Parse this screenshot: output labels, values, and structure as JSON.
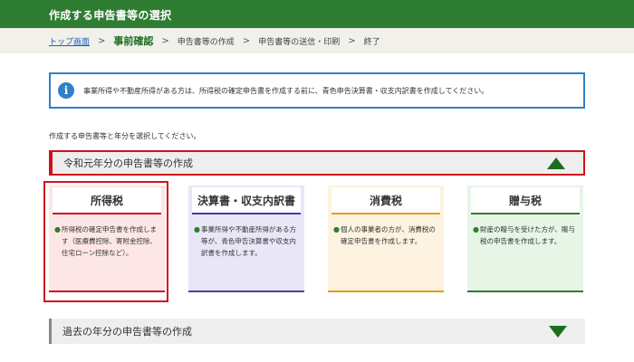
{
  "header": {
    "title": "作成する申告書等の選択"
  },
  "breadcrumb": {
    "items": [
      {
        "label": "トップ画面"
      },
      {
        "label": "事前確認"
      },
      {
        "label": "申告書等の作成"
      },
      {
        "label": "申告書等の送信・印刷"
      },
      {
        "label": "終了"
      }
    ],
    "separator": ">"
  },
  "info": {
    "icon": "i",
    "text": "事業所得や不動産所得がある方は、所得税の確定申告書を作成する前に、青色申告決算書・収支内訳書を作成してください。"
  },
  "instruction": "作成する申告書等と年分を選択してください。",
  "current_year": {
    "title": "令和元年分の申告書等の作成",
    "cards": [
      {
        "label": "所得税",
        "desc": "所得税の確定申告書を作成します（医療費控除、寄附金控除、住宅ローン控除など）。"
      },
      {
        "label": "決算書・収支内訳書",
        "desc": "事業所得や不動産所得がある方等が、青色申告決算書や収支内訳書を作成します。"
      },
      {
        "label": "消費税",
        "desc": "個人の事業者の方が、消費税の確定申告書を作成します。"
      },
      {
        "label": "贈与税",
        "desc": "財産の贈与を受けた方が、贈与税の申告書を作成します。"
      }
    ]
  },
  "past_years": {
    "title": "過去の年分の申告書等の作成"
  },
  "colors": {
    "header": "#2e7d32",
    "highlight": "#d0121b",
    "info_border": "#2f80c8",
    "card_income": "#fde6e6",
    "card_statement": "#e9e7f7",
    "card_consumption": "#fdf3e0",
    "card_gift": "#e6f5e6"
  },
  "icons": {
    "info": "info-circle-icon",
    "expand": "triangle-up-icon",
    "collapse": "triangle-down-icon",
    "bullet": "dot-icon"
  }
}
